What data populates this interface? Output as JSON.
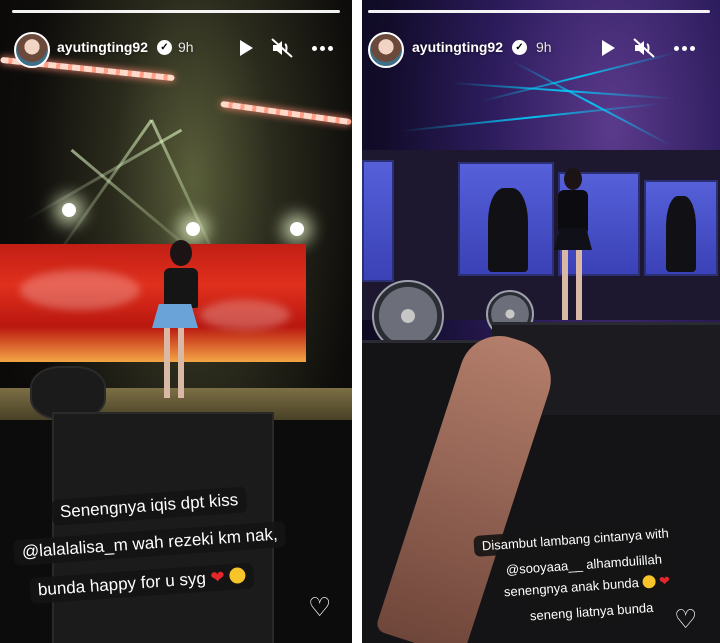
{
  "stories": [
    {
      "username": "ayutingting92",
      "time": "9h",
      "captions": [
        "Senengnya iqis dpt kiss",
        "@lalalalisa_m wah rezeki km nak,",
        "bunda happy for u syg"
      ],
      "caption_emojis": [
        "red-heart",
        "heart-eyes-face"
      ],
      "icons": [
        "play-icon",
        "mute-icon",
        "more-icon",
        "heart-icon"
      ]
    },
    {
      "username": "ayutingting92",
      "time": "9h",
      "captions": [
        "Disambut lambang cintanya with",
        "@sooyaaa__  alhamdulillah",
        "senengnya anak bunda",
        "seneng liatnya bunda"
      ],
      "caption_emojis": [
        "crying-face",
        "red-heart"
      ],
      "icons": [
        "play-icon",
        "mute-icon",
        "more-icon",
        "heart-icon"
      ]
    }
  ],
  "colors": {
    "progress": "#ffffff",
    "caption_bg": "#141414",
    "heart": "#e3272b"
  }
}
